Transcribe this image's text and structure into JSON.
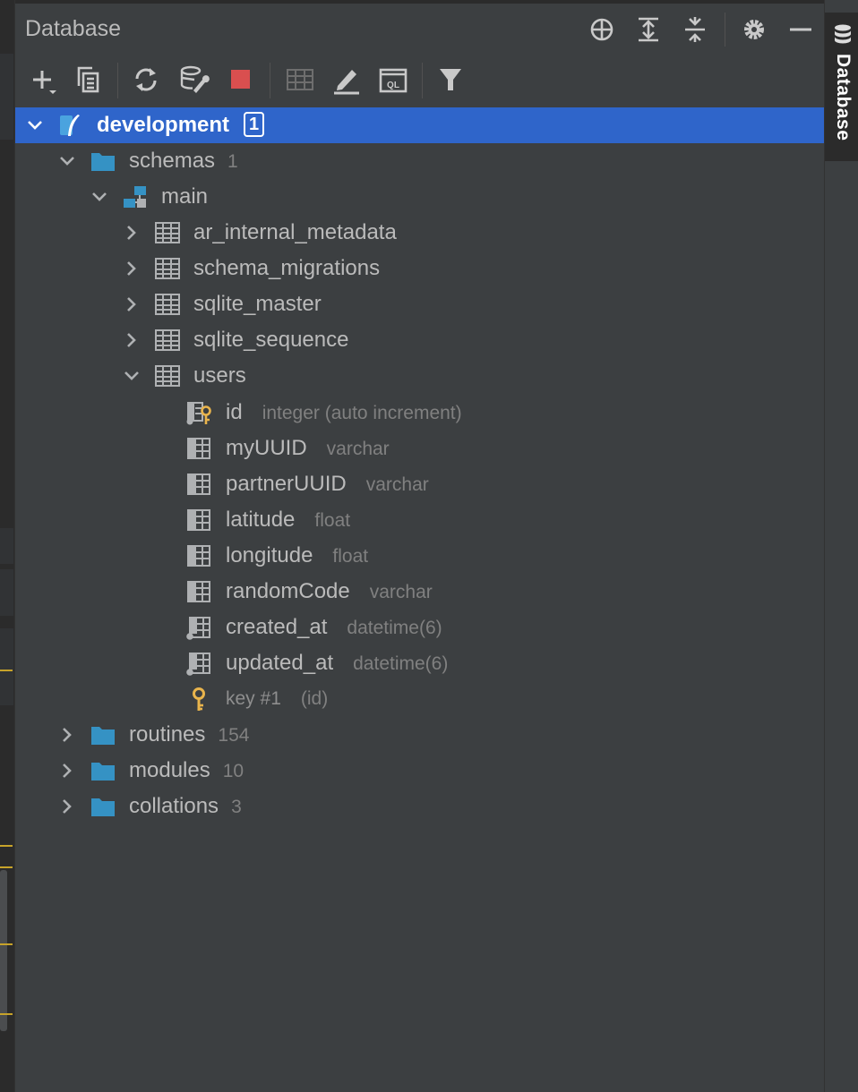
{
  "panel": {
    "title": "Database"
  },
  "side_tab": {
    "label": "Database"
  },
  "header_buttons": [
    "locate-icon",
    "expand-all-icon",
    "collapse-all-icon",
    "settings-icon",
    "minimize-icon"
  ],
  "toolbar_buttons": [
    "new-icon",
    "copy-icon",
    "refresh-icon",
    "properties-icon",
    "stop-icon",
    "table-view-icon",
    "edit-icon",
    "console-icon",
    "filter-icon"
  ],
  "tree": {
    "datasource": {
      "label": "development",
      "badge": "1"
    },
    "schemas": {
      "label": "schemas",
      "count": "1"
    },
    "main": {
      "label": "main"
    },
    "tables": [
      {
        "label": "ar_internal_metadata"
      },
      {
        "label": "schema_migrations"
      },
      {
        "label": "sqlite_master"
      },
      {
        "label": "sqlite_sequence"
      },
      {
        "label": "users"
      }
    ],
    "columns": [
      {
        "name": "id",
        "type": "integer (auto increment)",
        "icon": "pk-column-icon"
      },
      {
        "name": "myUUID",
        "type": "varchar",
        "icon": "column-icon"
      },
      {
        "name": "partnerUUID",
        "type": "varchar",
        "icon": "column-icon"
      },
      {
        "name": "latitude",
        "type": "float",
        "icon": "column-icon"
      },
      {
        "name": "longitude",
        "type": "float",
        "icon": "column-icon"
      },
      {
        "name": "randomCode",
        "type": "varchar",
        "icon": "column-icon"
      },
      {
        "name": "created_at",
        "type": "datetime(6)",
        "icon": "not-null-column-icon"
      },
      {
        "name": "updated_at",
        "type": "datetime(6)",
        "icon": "not-null-column-icon"
      }
    ],
    "key": {
      "label": "key #1",
      "detail": "(id)"
    },
    "folders": [
      {
        "label": "routines",
        "count": "154"
      },
      {
        "label": "modules",
        "count": "10"
      },
      {
        "label": "collations",
        "count": "3"
      }
    ]
  },
  "colors": {
    "background": "#3c3f41",
    "selection": "#2f65ca",
    "folder": "#3592c4",
    "key": "#e9b44c",
    "stop": "#d94f4f"
  }
}
